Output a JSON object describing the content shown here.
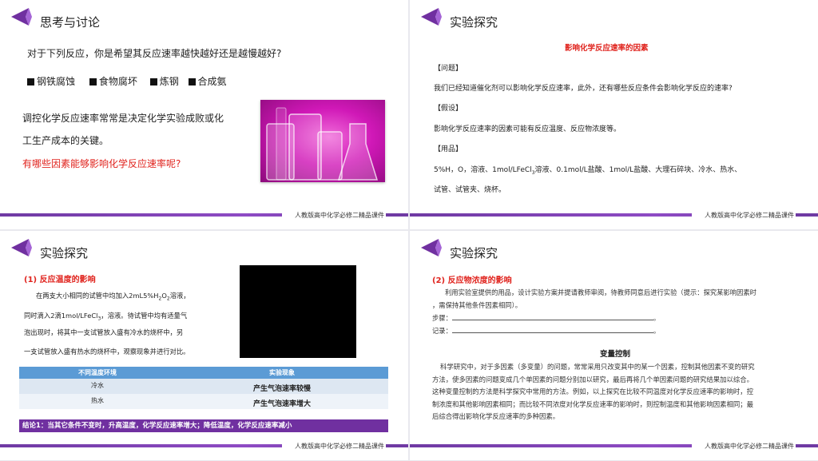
{
  "footer_text": "人教版高中化学必修二精品课件",
  "colors": {
    "purple": "#7030a0",
    "red": "#e0231d",
    "table_header": "#5b9bd5"
  },
  "slide1": {
    "title": "思考与讨论",
    "question": "对于下列反应，你是希望其反应速率越快越好还是越慢越好?",
    "items": [
      "钢铁腐蚀",
      "食物腐坏",
      "炼钢",
      "合成氨"
    ],
    "body_line1": "调控化学反应速率常常是决定化学实验成败或化",
    "body_line2": "工生产成本的关键。",
    "red_question": "有哪些因素能够影响化学反应速率呢?",
    "image_icon": "lab-glassware-photo"
  },
  "slide2": {
    "title": "实验探究",
    "heading": "影响化学反应速率的因素",
    "problem_label": "【问题】",
    "problem_text": "我们已经知道催化剂可以影响化学反应速率，此外，还有哪些反应条件会影响化学反应的速率?",
    "hypothesis_label": "【假设】",
    "hypothesis_text": "影响化学反应速率的因素可能有反应温度、反应物浓度等。",
    "materials_label": "【用品】",
    "materials_a": "5%H，O，溶液、1mol/LFeCl",
    "materials_sub": "3",
    "materials_b": "溶液、0.1mol/L盐酸、1mol/L盐酸、大理石碎块、冷水、热水、",
    "materials_line2": "试管、试管夹、烧杯。"
  },
  "slide3": {
    "title": "实验探究",
    "subheading": "(1) 反应温度的影响",
    "p1a": "在两支大小相同的试管中均加入2mL5%H",
    "p1s1": "2",
    "p1b": "O",
    "p1s2": "2",
    "p1c": "溶液，",
    "p2a": "同时滴入2滴1mol/LFeCl",
    "p2s": "3",
    "p2b": "，溶液。待试管中均有适量气",
    "p3": "泡出现时，将其中一支试管放入盛有冷水的烧杯中，另",
    "p4": "一支试管放入盛有热水的烧杯中，观察现象并进行对比。",
    "table": {
      "headers": [
        "不同温度环境",
        "实验现象"
      ],
      "rows": [
        [
          "冷水",
          "产生气泡速率较慢"
        ],
        [
          "热水",
          "产生气泡速率增大"
        ]
      ]
    },
    "conclusion": "结论1：当其它条件不变时，升高温度，化学反应速率增大；降低温度，化学反应速率减小"
  },
  "slide4": {
    "title": "实验探究",
    "subheading": "(2) 反应物浓度的影响",
    "intro1": "利用实验室提供的用品，设计实验方案并提请教师审阅，待教师同意后进行实验（提示：探究某影响因素时",
    "intro2": "，需保持其他条件因素相同）。",
    "steps_label": "步骤：",
    "record_label": "记录：",
    "period": "。",
    "section_title": "变量控制",
    "para": [
      "科学研究中，对于多因素（多变量）的问题，常常采用只改变其中的某一个因素，控制其他因素不变的研究",
      "方法，使多因素的问题变成几个单因素的问题分别加以研究，最后再将几个单因素问题的研究结果加以综合。",
      "这种变量控制的方法是科学探究中常用的方法。例如，以上探究在比较不同温度对化学反应速率的影响时，控",
      "制浓度和其他影响因素相同；而比较不同浓度对化学反应速率的影响时，则控制温度和其他影响因素相同；最",
      "后综合得出影响化学反应速率的多种因素。"
    ]
  }
}
